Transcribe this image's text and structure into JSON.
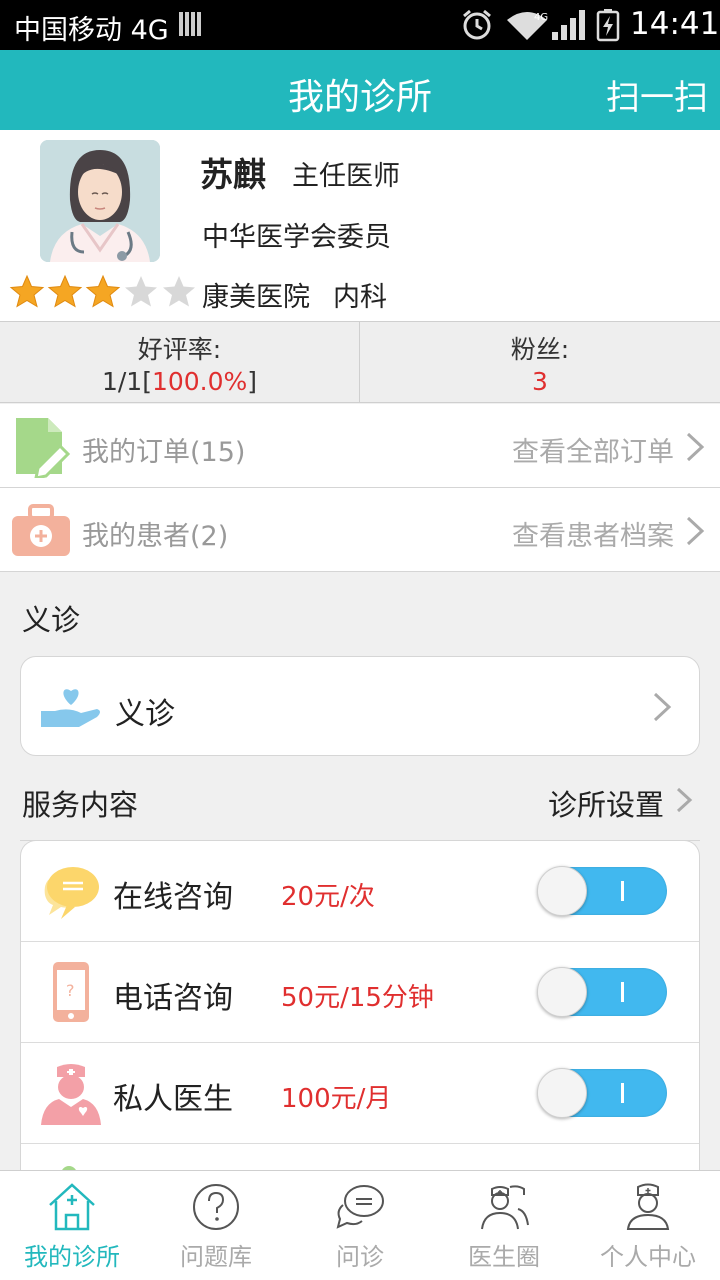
{
  "status_bar": {
    "carrier": "中国移动 4G",
    "network": "4G",
    "time": "14:41"
  },
  "header": {
    "title": "我的诊所",
    "scan": "扫一扫"
  },
  "profile": {
    "name": "苏麒",
    "title": "主任医师",
    "committee": "中华医学会委员",
    "hospital": "康美医院",
    "department": "内科",
    "rating_stars": 3,
    "rating_max": 5
  },
  "stats": {
    "rating_label": "好评率:",
    "rating_value_prefix": "1/1[",
    "rating_value_percent": "100.0%",
    "rating_value_suffix": "]",
    "fans_label": "粉丝:",
    "fans_value": "3"
  },
  "orders": {
    "label": "我的订单(15)",
    "link": "查看全部订单"
  },
  "patients": {
    "label": "我的患者(2)",
    "link": "查看患者档案"
  },
  "free_clinic": {
    "section_title": "义诊",
    "item_label": "义诊"
  },
  "services": {
    "section_title": "服务内容",
    "settings_label": "诊所设置",
    "items": [
      {
        "name": "在线咨询",
        "price": "20元/次",
        "enabled": true
      },
      {
        "name": "电话咨询",
        "price": "50元/15分钟",
        "enabled": true
      },
      {
        "name": "私人医生",
        "price": "100元/月",
        "enabled": true
      }
    ]
  },
  "tabbar": {
    "items": [
      {
        "label": "我的诊所",
        "active": true
      },
      {
        "label": "问题库",
        "active": false
      },
      {
        "label": "问诊",
        "active": false
      },
      {
        "label": "医生圈",
        "active": false
      },
      {
        "label": "个人中心",
        "active": false
      }
    ]
  },
  "colors": {
    "primary": "#22b8bd",
    "price_red": "#e02f2f",
    "toggle_blue": "#41b8ef",
    "star_gold": "#f5a623"
  }
}
